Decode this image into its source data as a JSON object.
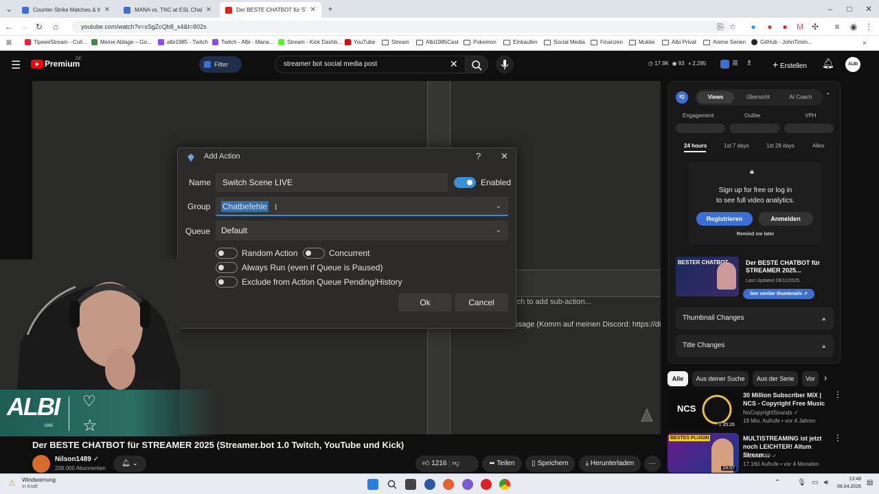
{
  "browser": {
    "tabs": [
      {
        "title": "Counter-Strike Matches & livesc"
      },
      {
        "title": "MANA vs. TNC at ESL Challenge"
      },
      {
        "title": "Der BESTE CHATBOT für STREA"
      }
    ],
    "url": "youtube.com/watch?v=xSgZcQb8_x4&t=602s",
    "bookmarks": [
      "TipeeeStream - Coll...",
      "Meine Ablage – Go...",
      "albi1985 - Twitch",
      "Twitch - Albi - Mana...",
      "Stream - Kick Dashb...",
      "YouTube",
      "Stream",
      "Albi1985Cast",
      "Pokemon",
      "Einkaufen",
      "Social Media",
      "Finanzen",
      "Mukke",
      "Albi Privat",
      "Anime Serien",
      "GitHub - JohnTimm..."
    ]
  },
  "youtube": {
    "logo": "Premium",
    "region": "DE",
    "filter_label": "Filter",
    "search_value": "streamer bot social media post",
    "stats": {
      "views": "17.9K",
      "likes": "93",
      "subs": "2,285"
    },
    "create_label": "Erstellen",
    "avatar_text": "ALBI"
  },
  "dialog": {
    "title": "Add Action",
    "help": "?",
    "name_label": "Name",
    "name_value": "Switch Scene LIVE",
    "enabled_label": "Enabled",
    "group_label": "Group",
    "group_value": "Chatbefehle",
    "queue_label": "Queue",
    "queue_value": "Default",
    "options": {
      "random": "Random Action",
      "concurrent": "Concurrent",
      "always_run": "Always Run (even if Queue is Paused)",
      "exclude": "Exclude from Action Queue Pending/History"
    },
    "ok": "Ok",
    "cancel": "Cancel"
  },
  "video_bg": {
    "subaction_hint": "rch to add sub-action...",
    "message_hint": "ssage (Komm auf meinen Discord: https://di"
  },
  "overlay": {
    "logo": "ALBI",
    "year": "1985"
  },
  "video_info": {
    "title": "Der BESTE CHATBOT für STREAMER 2025 (Streamer.bot 1.0 Twitch, YouTube und Kick)",
    "channel": "Nilson1489",
    "subscribers": "208.000 Abonnenten",
    "likes": "1216",
    "share": "Teilen",
    "save": "Speichern",
    "download": "Herunterladen",
    "more": "···"
  },
  "iq_panel": {
    "badge": "IQ",
    "tabs": [
      "Views",
      "Übersicht",
      "AI Coach"
    ],
    "metrics": [
      "Engagement",
      "Outlier",
      "VPH"
    ],
    "ranges": [
      "24 hours",
      "1st 7 days",
      "1st 28 days",
      "Alles"
    ],
    "signup_text_1": "Sign up for free or log in",
    "signup_text_2": "to see full video analytics.",
    "register": "Registrieren",
    "login": "Anmelden",
    "remind": "Remind me later",
    "thumb_caption": "BESTER CHATBOT",
    "video_title": "Der BESTE CHATBOT für STREAMER 2025...",
    "last_updated": "Last Updated 09/11/2025",
    "similar": "See similar thumbnails",
    "thumbnail_changes": "Thumbnail Changes",
    "title_changes": "Title Changes"
  },
  "chips": [
    "Alle",
    "Aus deiner Suche",
    "Aus der Serie",
    "Vor"
  ],
  "recommendations": [
    {
      "title": "30 Million Subscriber MIX | NCS - Copyright Free Music",
      "channel": "NoCopyrightSounds",
      "meta": "19 Mio. Aufrufe • vor 4 Jahren",
      "duration": "1:35:26",
      "thumb_text": "NCS"
    },
    {
      "title": "MULTISTREAMING ist jetzt noch LEICHTER! Altum Stream...",
      "channel": "Nilson1489",
      "meta": "17.160 Aufrufe • vor 4 Monaten",
      "duration": "24:57",
      "thumb_text": "BESTES PLUGIN"
    }
  ],
  "taskbar": {
    "weather_title": "Windwarnung",
    "weather_sub": "In Kraft",
    "time": "13:48",
    "date": "06.04.2026"
  }
}
